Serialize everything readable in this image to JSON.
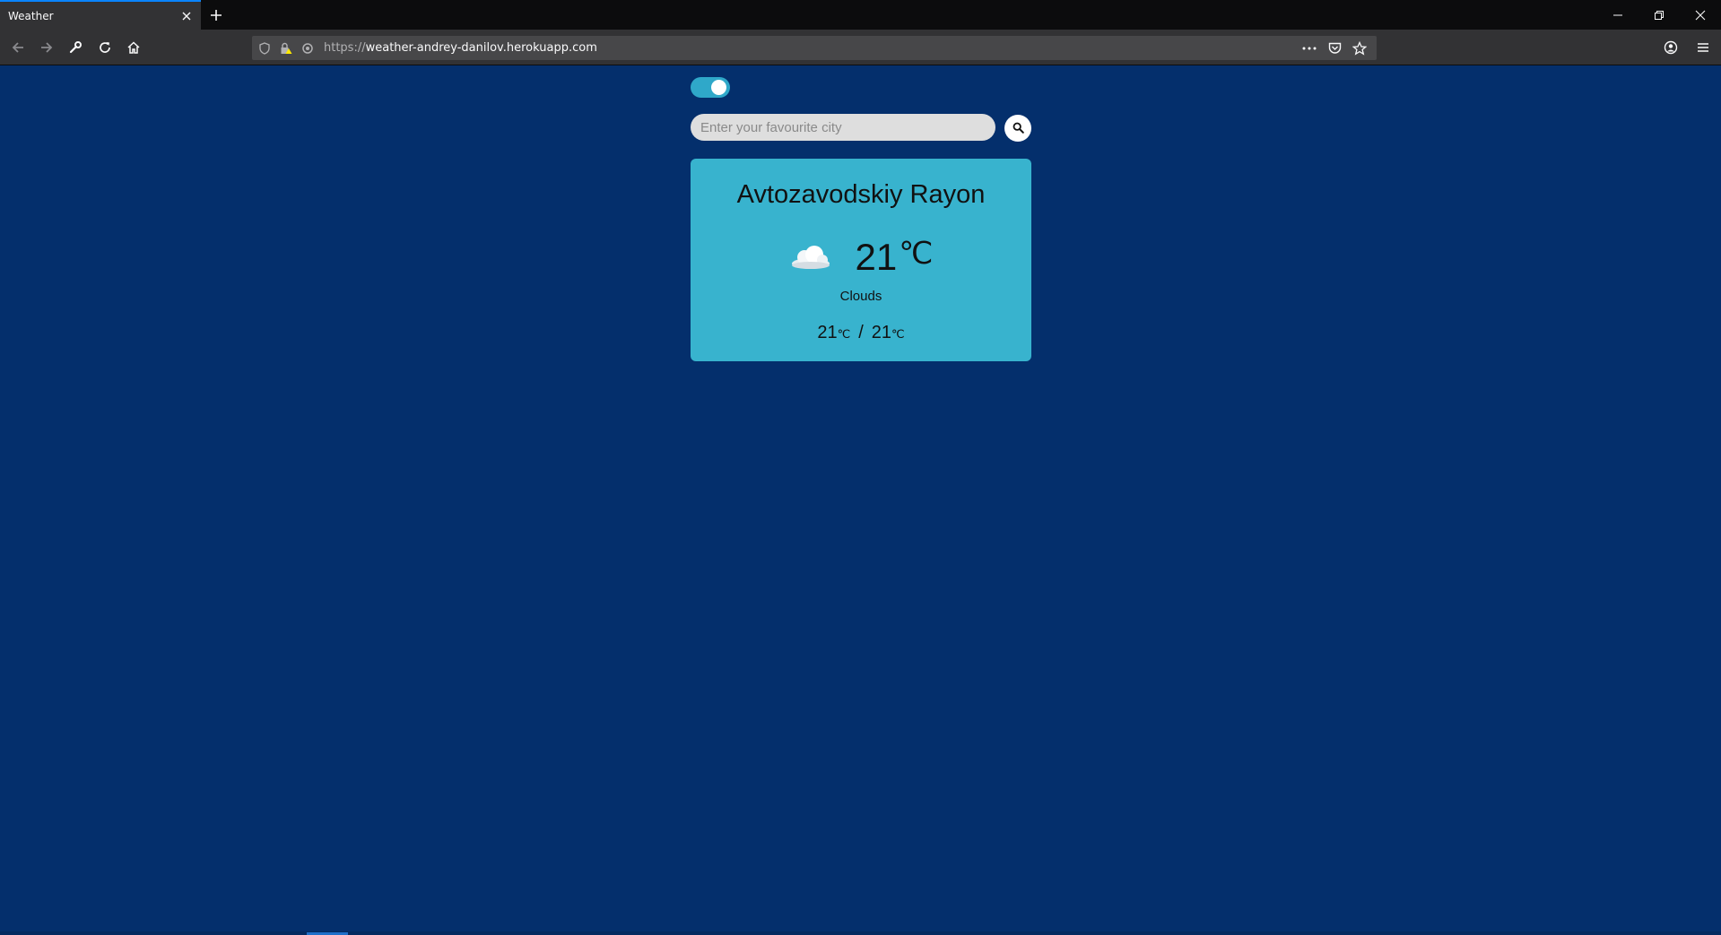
{
  "browser": {
    "tab_title": "Weather",
    "url_prefix": "https://",
    "url_host": "weather-andrey-danilov.herokuapp.com",
    "accent_color": "#0a84ff"
  },
  "toggle": {
    "state": "on",
    "color": "#2fa8c9"
  },
  "search": {
    "placeholder": "Enter your favourite city",
    "value": ""
  },
  "weather_card": {
    "city": "Avtozavodskiy Rayon",
    "icon": "cloud-icon",
    "temperature": "21",
    "temperature_unit": "℃",
    "description": "Clouds",
    "temp_min": "21",
    "temp_min_unit": "℃",
    "separator": "/",
    "temp_max": "21",
    "temp_max_unit": "℃",
    "card_color": "#38b3ce"
  },
  "page": {
    "background_color": "#042f6c"
  }
}
